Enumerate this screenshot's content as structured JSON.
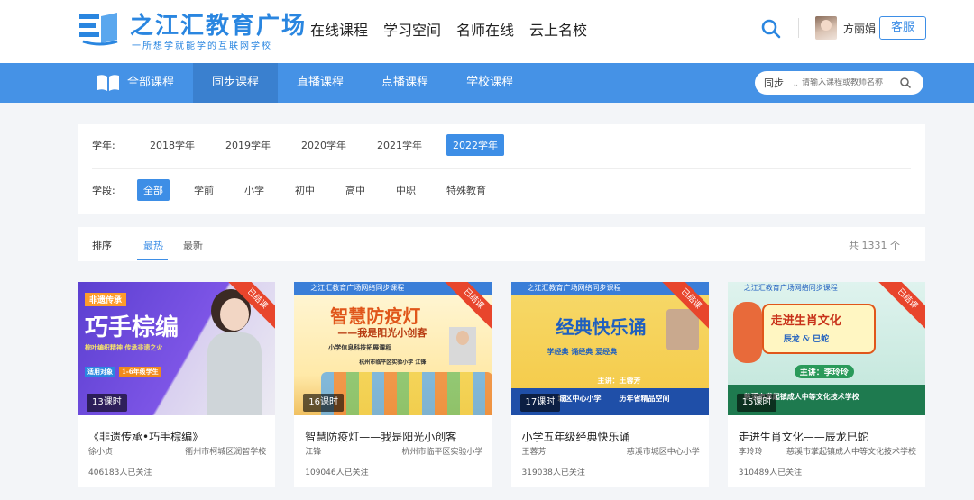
{
  "logo": {
    "title": "之江汇教育广场",
    "subtitle": "一所想学就能学的互联网学校",
    "brand_color": "#2a86e0"
  },
  "topnav": [
    "在线课程",
    "学习空间",
    "名师在线",
    "云上名校"
  ],
  "user": {
    "name": "方丽娟",
    "service_label": "客服"
  },
  "catnav": {
    "items": [
      "全部课程",
      "同步课程",
      "直播课程",
      "点播课程",
      "学校课程"
    ],
    "active_index": 1
  },
  "search": {
    "scope": "同步",
    "placeholder": "请输入课程或教师名称"
  },
  "filters": {
    "year": {
      "label": "学年:",
      "options": [
        "2018学年",
        "2019学年",
        "2020学年",
        "2021学年",
        "2022学年"
      ],
      "active_index": 4
    },
    "stage": {
      "label": "学段:",
      "options": [
        "全部",
        "学前",
        "小学",
        "初中",
        "高中",
        "中职",
        "特殊教育"
      ],
      "active_index": 0
    }
  },
  "sort": {
    "label": "排序",
    "tabs": [
      "最热",
      "最新"
    ],
    "active_index": 0,
    "total": "共 1331 个"
  },
  "accent": "#3d8ee6",
  "cards": [
    {
      "title": "《非遗传承•巧手棕编》",
      "teacher": "徐小贞",
      "school": "衢州市柯城区润智学校",
      "followers": "406183人已关注",
      "lessons": "13课时",
      "badge": "已结课",
      "thumb_text": {
        "tag": "非遗传承",
        "main": "巧手棕编",
        "slogan": "棕叶编织精神 传承非遗之火",
        "target": "适用对象",
        "grade": "1-6年级学生"
      }
    },
    {
      "title": "智慧防疫灯——我是阳光小创客",
      "teacher": "江锋",
      "school": "杭州市临平区实验小学",
      "followers": "109046人已关注",
      "lessons": "16课时",
      "badge": "已结课",
      "thumb_text": {
        "banner": "之江汇教育广场网络同步课程",
        "main": "智慧防疫灯",
        "sub": "——我是阳光小创客",
        "line": "小学信息科技拓展课程",
        "school": "杭州市临平区实验小学 江锋"
      }
    },
    {
      "title": "小学五年级经典快乐诵",
      "teacher": "王蓉芳",
      "school": "慈溪市城区中心小学",
      "followers": "319038人已关注",
      "lessons": "17课时",
      "badge": "已结课",
      "thumb_text": {
        "banner": "之江汇教育广场网络同步课程",
        "main": "经典快乐诵",
        "sub": "学经典 诵经典 爱经典",
        "speaker": "主讲：王蓉芳",
        "school": "城区中心小学",
        "footer": "历年省精品空间"
      }
    },
    {
      "title": "走进生肖文化——辰龙巳蛇",
      "teacher": "李玲玲",
      "school": "慈溪市掌起镇成人中等文化技术学校",
      "followers": "310489人已关注",
      "lessons": "15课时",
      "badge": "已结课",
      "thumb_text": {
        "banner": "之江汇教育广场网络同步课程",
        "main": "走进生肖文化",
        "sub": "辰龙 & 巳蛇",
        "speaker": "主讲：李玲玲",
        "school": "慈溪市掌起镇成人中等文化技术学校"
      }
    }
  ]
}
